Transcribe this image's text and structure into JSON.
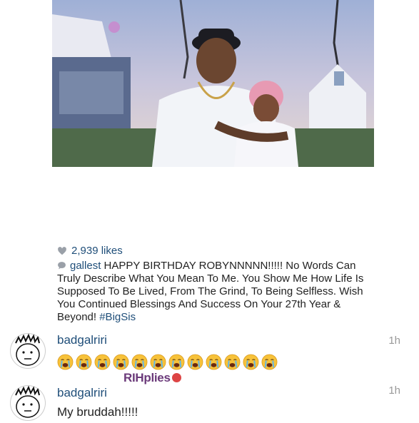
{
  "post": {
    "likes_count": "2,939 likes",
    "caption_user": "gallest",
    "caption_text": "HAPPY BIRTHDAY ROBYNNNNN!!!!! No Words Can Truly Describe What You Mean To Me. You Show Me How Life Is Supposed To Be Lived, From The Grind, To Being Selfless. Wish You Continued Blessings And Success On Your 27th Year & Beyond!",
    "caption_hashtag": "#BigSis"
  },
  "comments": [
    {
      "user": "badgalriri",
      "time": "1h",
      "emoji_count": 12,
      "emoji_name": "crying-face"
    },
    {
      "user": "badgalriri",
      "time": "1h",
      "text": "My bruddah!!!!!"
    }
  ],
  "watermark": {
    "text": "RIHplies"
  },
  "colors": {
    "link": "#1f4e79",
    "time": "#999999",
    "text": "#222222"
  }
}
